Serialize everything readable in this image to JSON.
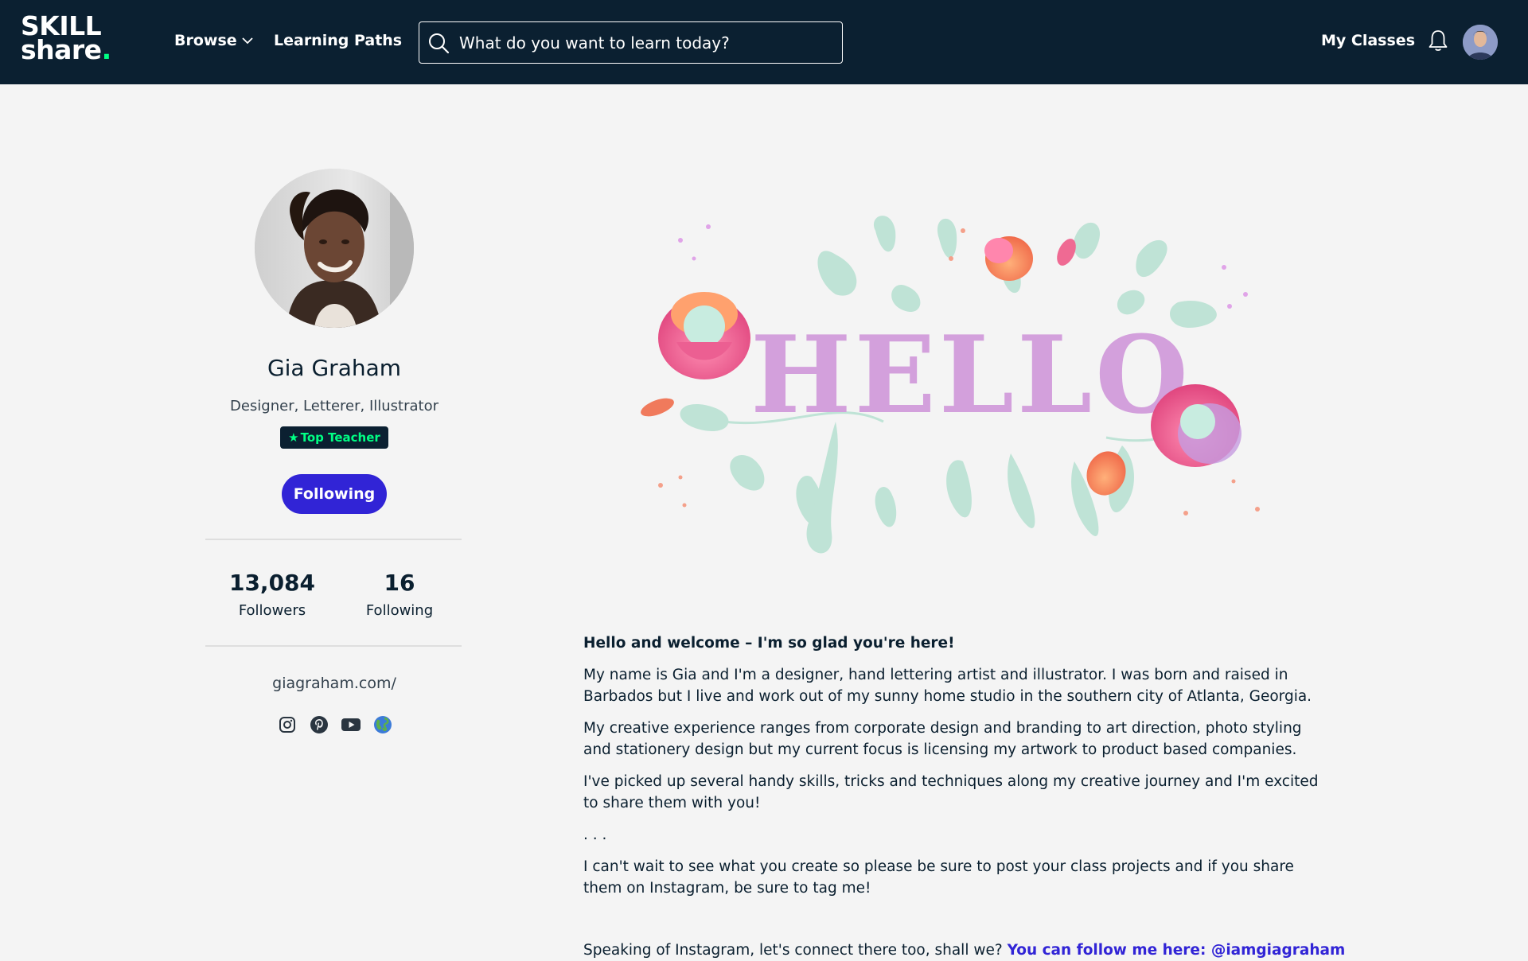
{
  "header": {
    "logo_line1": "SKILL",
    "logo_line2": "share",
    "logo_dot": ".",
    "browse_label": "Browse",
    "learning_paths_label": "Learning Paths",
    "search_placeholder": "What do you want to learn today?",
    "my_classes_label": "My Classes"
  },
  "profile": {
    "name": "Gia Graham",
    "tagline": "Designer, Letterer, Illustrator",
    "badge_star": "★",
    "badge_label": "Top Teacher",
    "follow_button_label": "Following",
    "followers_count": "13,084",
    "followers_label": "Followers",
    "following_count": "16",
    "following_label": "Following",
    "website": "giagraham.com/",
    "social_icons": [
      "instagram-icon",
      "pinterest-icon",
      "youtube-icon",
      "globe-icon"
    ]
  },
  "hero": {
    "lettering": "HELLO"
  },
  "bio": {
    "lead": "Hello and welcome – I'm so glad you're here!",
    "p1": "My name is Gia and I'm a designer, hand lettering artist and illustrator. I was born and raised in Barbados but I live and work out of my sunny home studio in the southern city of Atlanta, Georgia.",
    "p2": "My creative experience ranges from corporate design and branding to art direction, photo styling and stationery design but my current focus is licensing my artwork to product based companies.",
    "p3": "I've picked up several handy skills, tricks and techniques along my creative journey and I'm excited to share them with you!",
    "p4": ". . .",
    "p5": "I can't wait to see what you create so please be sure to post your class projects and if you share them on Instagram, be sure to tag me!",
    "ig_text": "Speaking of Instagram, let's connect there too, shall we?",
    "ig_link": "You can follow me here: @iamgiagraham"
  },
  "colors": {
    "header_bg": "#0b2031",
    "accent_green": "#00ff84",
    "button_blue": "#3124d6",
    "page_bg": "#f4f4f4"
  }
}
